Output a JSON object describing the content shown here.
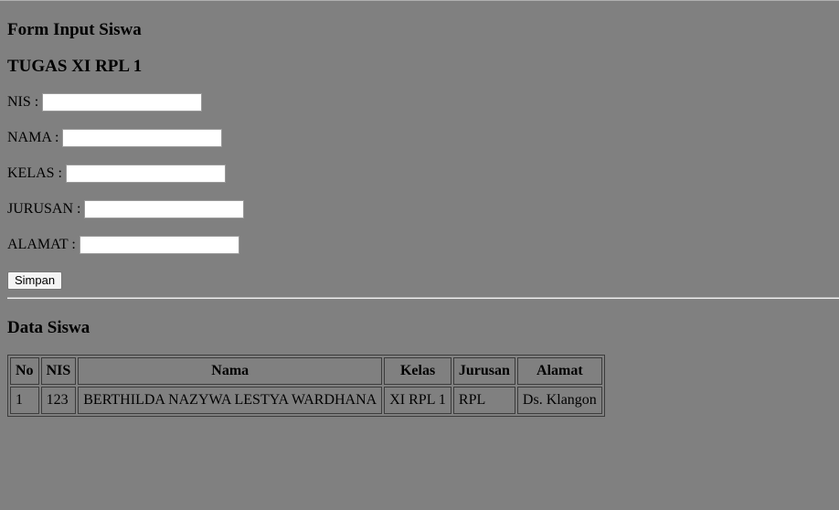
{
  "form": {
    "title": "Form Input Siswa",
    "subtitle": "TUGAS XI RPL 1",
    "fields": [
      {
        "label": "NIS :",
        "value": ""
      },
      {
        "label": "NAMA :",
        "value": ""
      },
      {
        "label": "KELAS :",
        "value": ""
      },
      {
        "label": "JURUSAN :",
        "value": ""
      },
      {
        "label": "ALAMAT :",
        "value": ""
      }
    ],
    "submit_label": "Simpan"
  },
  "data_section": {
    "title": "Data Siswa",
    "columns": [
      "No",
      "NIS",
      "Nama",
      "Kelas",
      "Jurusan",
      "Alamat"
    ],
    "rows": [
      [
        "1",
        "123",
        "BERTHILDA NAZYWA LESTYA WARDHANA",
        "XI RPL 1",
        "RPL",
        "Ds. Klangon"
      ]
    ]
  }
}
